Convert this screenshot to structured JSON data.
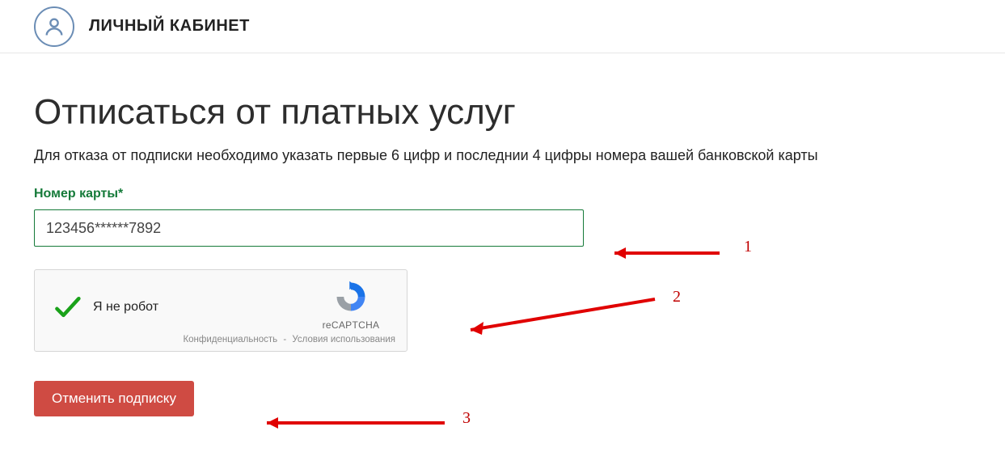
{
  "header": {
    "title": "ЛИЧНЫЙ КАБИНЕТ"
  },
  "main": {
    "title": "Отписаться от платных услуг",
    "subtitle": "Для отказа от подписки необходимо указать первые 6 цифр и последнии 4 цифры номера вашей банковской карты"
  },
  "form": {
    "card_label": "Номер карты*",
    "card_value": "123456******7892"
  },
  "recaptcha": {
    "label": "Я не робот",
    "brand": "reCAPTCHA",
    "privacy": "Конфиденциальность",
    "terms": "Условия использования",
    "separator": "-"
  },
  "buttons": {
    "cancel_subscription": "Отменить подписку"
  },
  "annotations": {
    "n1": "1",
    "n2": "2",
    "n3": "3"
  }
}
